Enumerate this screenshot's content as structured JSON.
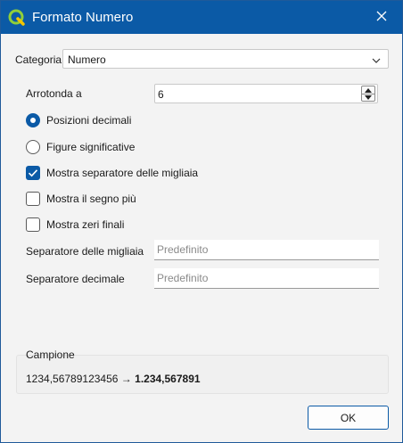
{
  "window": {
    "title": "Formato Numero",
    "colors": {
      "accent": "#0b5aa6",
      "background": "#f3f3f3",
      "titlebar": "#0b5aa6"
    }
  },
  "titlebar_icons": {
    "app": "qgis-logo-icon",
    "close": "close-icon"
  },
  "category": {
    "label": "Categoria",
    "value": "Numero"
  },
  "round_to": {
    "label": "Arrotonda a",
    "value": "6"
  },
  "radios": [
    {
      "label": "Posizioni decimali",
      "selected": true
    },
    {
      "label": "Figure significative",
      "selected": false
    }
  ],
  "checkboxes": [
    {
      "label": "Mostra separatore delle migliaia",
      "checked": true
    },
    {
      "label": "Mostra il segno più",
      "checked": false
    },
    {
      "label": "Mostra zeri finali",
      "checked": false
    }
  ],
  "thousands_separator": {
    "label": "Separatore delle migliaia",
    "placeholder": "Predefinito",
    "value": ""
  },
  "decimal_separator": {
    "label": "Separatore decimale",
    "placeholder": "Predefinito",
    "value": ""
  },
  "sample": {
    "label": "Campione",
    "input": "1234,56789123456",
    "arrow": "→",
    "output": "1.234,567891"
  },
  "buttons": {
    "ok": "OK"
  }
}
